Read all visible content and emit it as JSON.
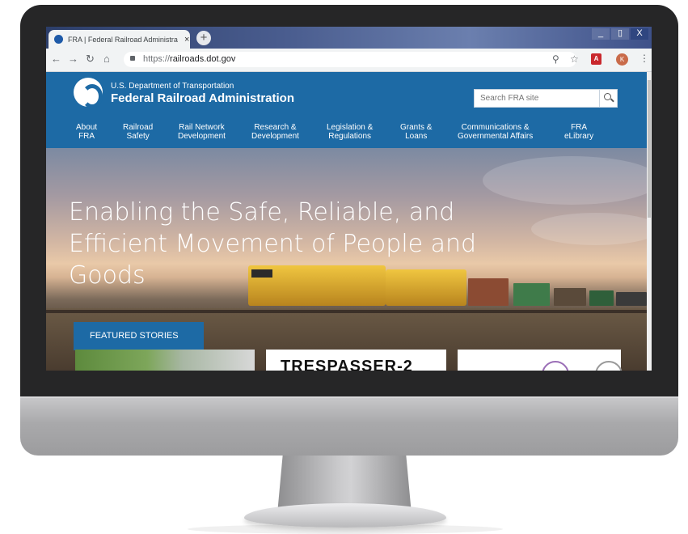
{
  "browser": {
    "tab_title": "FRA | Federal Railroad Administra",
    "tab_close": "×",
    "new_tab": "+",
    "url_scheme": "https://",
    "url_host": "railroads.dot.gov",
    "window_minimize": "_",
    "window_maximize": "▯",
    "window_close": "X",
    "avatar_letter": "K"
  },
  "site": {
    "agency_small": "U.S. Department of Transportation",
    "agency_name": "Federal Railroad Administration",
    "search_placeholder": "Search FRA site",
    "nav": [
      {
        "l1": "About",
        "l2": "FRA"
      },
      {
        "l1": "Railroad",
        "l2": "Safety"
      },
      {
        "l1": "Rail Network",
        "l2": "Development"
      },
      {
        "l1": "Research &",
        "l2": "Development"
      },
      {
        "l1": "Legislation &",
        "l2": "Regulations"
      },
      {
        "l1": "Grants &",
        "l2": "Loans"
      },
      {
        "l1": "Communications &",
        "l2": "Governmental Affairs"
      },
      {
        "l1": "FRA",
        "l2": "eLibrary"
      }
    ],
    "hero": {
      "line1": "Enabling the Safe, Reliable, and",
      "line2": "Efficient Movement of People and",
      "line3": "Goods"
    },
    "featured_label": "FEATURED STORIES",
    "card2_text": "TRESPASSER-2"
  },
  "colors": {
    "brand_blue": "#1d6aa5",
    "bezel": "#262627"
  }
}
